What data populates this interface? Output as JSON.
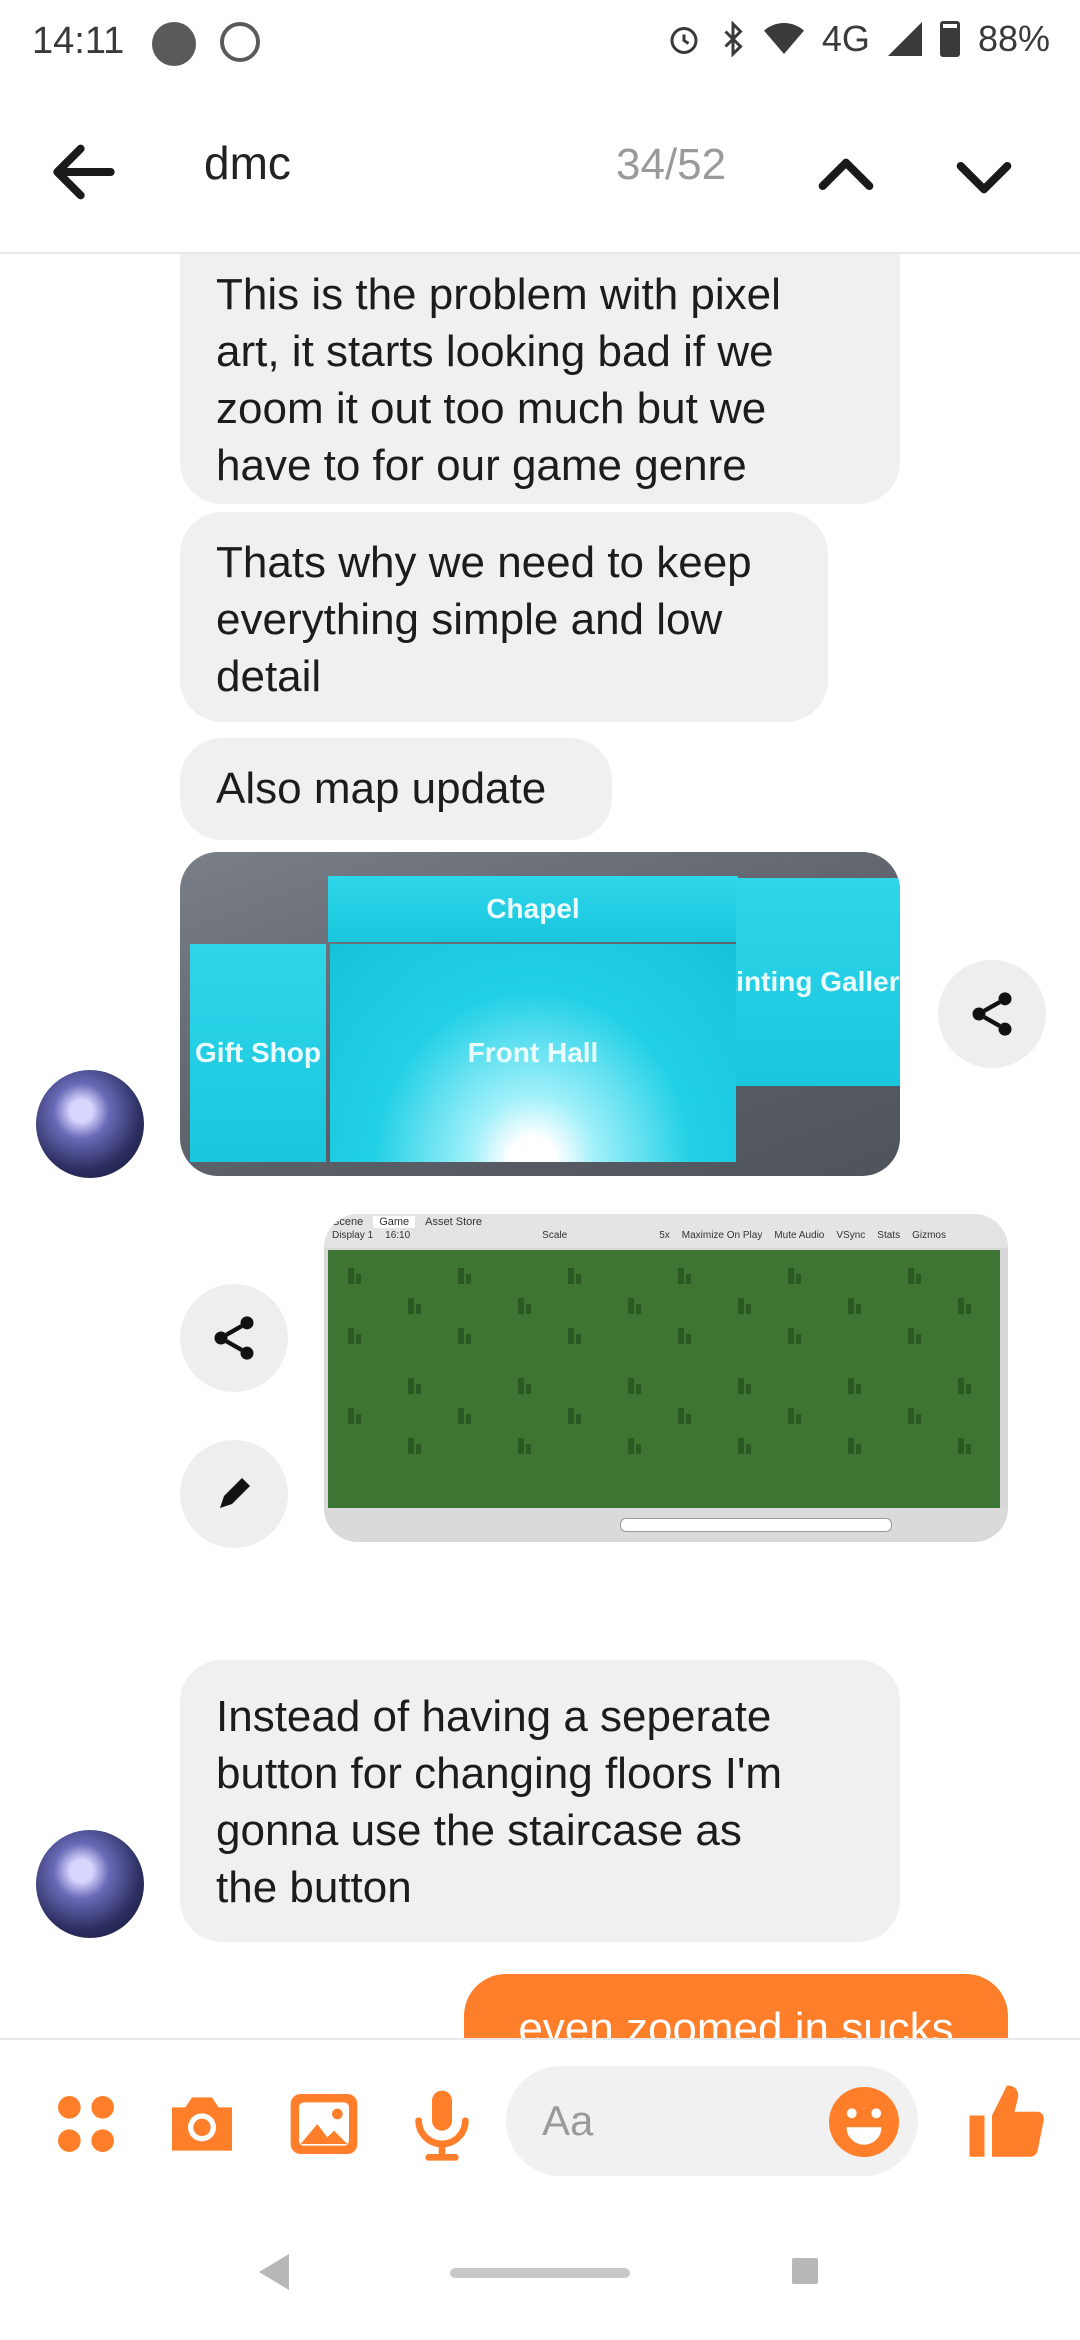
{
  "status_bar": {
    "time": "14:11",
    "network": "4G",
    "battery": "88%"
  },
  "search": {
    "query": "dmc",
    "counter": "34/52"
  },
  "messages": [
    {
      "text": "This is the problem with pixel\nart, it starts looking bad if we\nzoom it out too much but we\nhave to for our game genre"
    },
    {
      "text": "Thats why we need to keep\neverything simple and low\ndetail"
    },
    {
      "text": "Also map update"
    },
    {
      "text": "Instead of having a seperate\nbutton for changing floors I'm\ngonna use the staircase as\nthe button"
    },
    {
      "text": "even zoomed in sucks"
    }
  ],
  "map_image": {
    "rooms": [
      "Chapel",
      "Painting Galler",
      "Gift Shop",
      "Front Hall"
    ]
  },
  "game_image": {
    "tabs": [
      "Scene",
      "Game",
      "Asset Store"
    ],
    "toolbar": [
      "Display 1",
      "16:10",
      "Scale",
      "5x",
      "Maximize On Play",
      "Mute Audio",
      "VSync",
      "Stats",
      "Gizmos"
    ]
  },
  "composer": {
    "placeholder": "Aa"
  },
  "colors": {
    "accent": "#ff7e29",
    "bubble": "#f0f0f0",
    "map_room": "#1fcfe4",
    "grass": "#3e7532"
  }
}
